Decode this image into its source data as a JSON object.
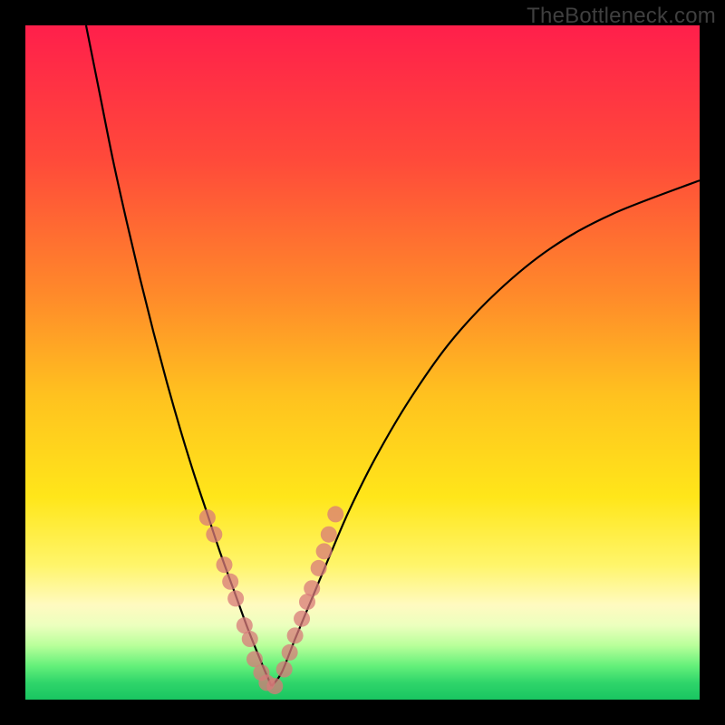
{
  "watermark": "TheBottleneck.com",
  "chart_data": {
    "type": "line",
    "title": "",
    "xlabel": "",
    "ylabel": "",
    "xlim": [
      0,
      100
    ],
    "ylim": [
      0,
      100
    ],
    "grid": false,
    "legend": false,
    "gradient_stops": [
      {
        "offset": 0.0,
        "color": "#ff1f4b"
      },
      {
        "offset": 0.2,
        "color": "#ff4a3a"
      },
      {
        "offset": 0.4,
        "color": "#ff8a2a"
      },
      {
        "offset": 0.55,
        "color": "#ffc21f"
      },
      {
        "offset": 0.7,
        "color": "#ffe61a"
      },
      {
        "offset": 0.8,
        "color": "#fff56a"
      },
      {
        "offset": 0.86,
        "color": "#fffac0"
      },
      {
        "offset": 0.89,
        "color": "#ecffbe"
      },
      {
        "offset": 0.92,
        "color": "#b8ff9a"
      },
      {
        "offset": 0.95,
        "color": "#64f07a"
      },
      {
        "offset": 0.975,
        "color": "#2fd56a"
      },
      {
        "offset": 1.0,
        "color": "#19c561"
      }
    ],
    "series": [
      {
        "name": "left-curve",
        "color": "#000000",
        "x": [
          9.0,
          11.0,
          13.0,
          15.0,
          17.0,
          19.0,
          21.0,
          23.0,
          25.0,
          27.0,
          29.0,
          31.0,
          33.0,
          35.0,
          36.5
        ],
        "y": [
          100.0,
          90.0,
          80.0,
          71.0,
          62.5,
          54.5,
          47.0,
          40.0,
          33.5,
          27.5,
          21.5,
          16.0,
          10.5,
          5.5,
          2.0
        ]
      },
      {
        "name": "right-curve",
        "color": "#000000",
        "x": [
          36.5,
          38.0,
          40.0,
          42.5,
          45.0,
          48.0,
          52.0,
          57.0,
          63.0,
          70.0,
          78.0,
          87.0,
          100.0
        ],
        "y": [
          2.0,
          4.0,
          9.0,
          15.0,
          21.0,
          28.0,
          36.0,
          44.5,
          53.0,
          60.5,
          67.0,
          72.0,
          77.0
        ]
      }
    ],
    "markers": {
      "name": "scatter-points",
      "color": "#d87a7a",
      "opacity": 0.75,
      "radius": 9,
      "x": [
        27.0,
        28.0,
        29.5,
        30.4,
        31.2,
        32.5,
        33.3,
        34.0,
        35.0,
        35.8,
        37.0,
        38.4,
        39.2,
        40.0,
        41.0,
        41.8,
        42.5,
        43.5,
        44.3,
        45.0,
        46.0
      ],
      "y": [
        27.0,
        24.5,
        20.0,
        17.5,
        15.0,
        11.0,
        9.0,
        6.0,
        4.0,
        2.5,
        2.0,
        4.5,
        7.0,
        9.5,
        12.0,
        14.5,
        16.5,
        19.5,
        22.0,
        24.5,
        27.5
      ]
    }
  }
}
